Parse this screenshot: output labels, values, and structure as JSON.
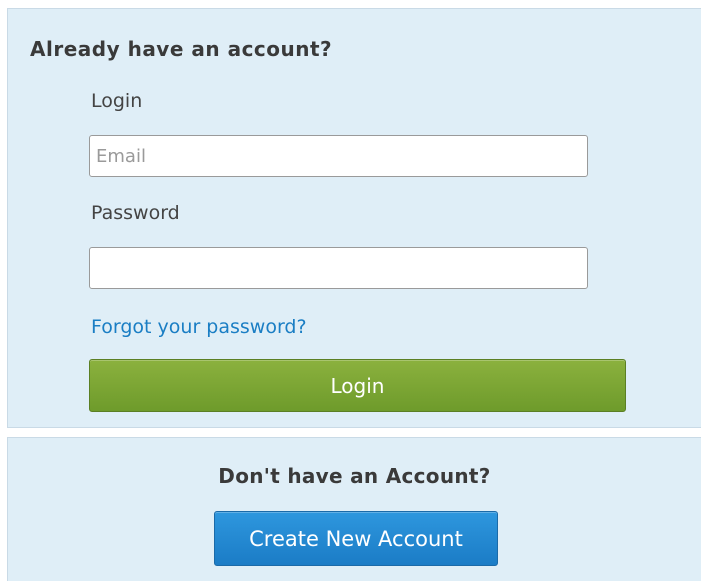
{
  "login_panel": {
    "heading": "Already have an account?",
    "login_label": "Login",
    "email_placeholder": "Email",
    "email_value": "",
    "password_label": "Password",
    "password_value": "",
    "forgot_link": "Forgot your password?",
    "login_button": "Login"
  },
  "signup_panel": {
    "heading": "Don't have an Account?",
    "create_button": "Create New Account"
  },
  "colors": {
    "panel_background": "#dfeef7",
    "login_button": "#7aa534",
    "create_button": "#2589d2",
    "link": "#1a7ec4"
  }
}
